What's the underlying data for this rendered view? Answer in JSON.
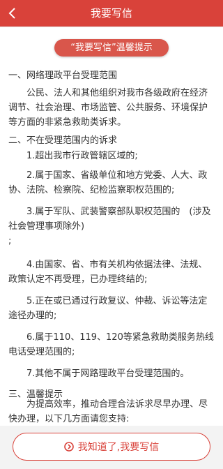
{
  "header": {
    "title": "我要写信",
    "back_icon": "chevron-left-icon"
  },
  "notice": {
    "pill": "“我要写信”温馨提示"
  },
  "sections": {
    "s1_title": "一、网络理政平台受理范围",
    "s1_body": "公民、法人和其他组织对我市各级政府在经济调节、社会治理、市场监管、公共服务、环境保护等方面的非紧急救助类诉求。",
    "s2_title": "二、不在受理范围内的诉求",
    "item1": "1.超出我市行政管辖区域的;",
    "item2": "2.属于国家、省级单位和地方党委、人大、政协、法院、检察院、纪检监察职权范围的;",
    "item3": "3.属于军队、武装警察部队职权范围的　(涉及社会管理事项除外)",
    "item3_tail": ";",
    "item4": "4.由国家、省、市有关机构依据法律、法规、政策认定不再受理，已办理终结的;",
    "item5": "5.正在或已通过行政复议、仲裁、诉讼等法定途径办理的;",
    "item6": "6.属于110、119、120等紧急救助类服务热线电话受理范围的;",
    "item7": "7.其他不属于网路理政平台受理范围的。",
    "s3_title": "三、温馨提示",
    "s3_body": "为提高效率，推动合理合法诉求尽早办理、尽快办理，以下几方面请您支持:"
  },
  "footer": {
    "button_label": "我知道了,我要写信",
    "button_icon": "chevron-right-circle-icon"
  },
  "colors": {
    "accent": "#d9423a",
    "pill": "#d9564b"
  }
}
